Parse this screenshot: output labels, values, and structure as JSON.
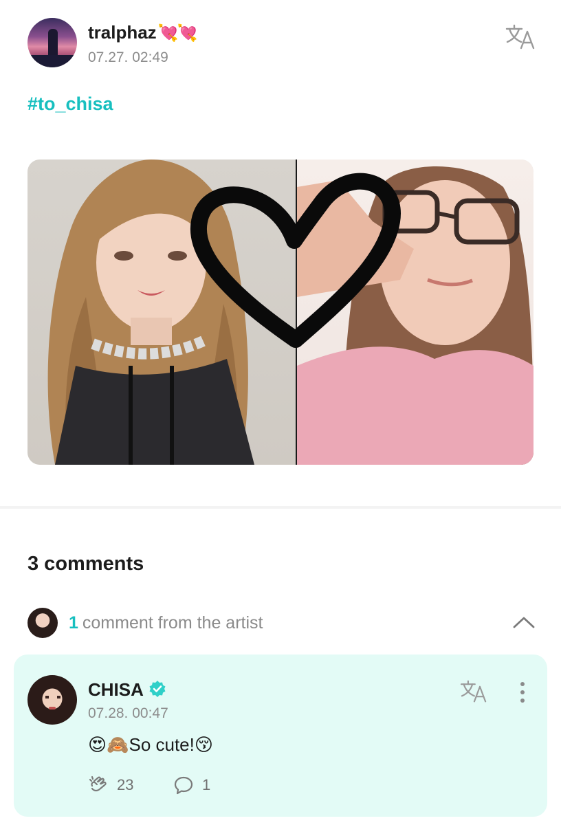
{
  "post": {
    "username": "tralphaz",
    "username_emoji": "💘💘",
    "time": "07.27. 02:49",
    "hashtag": "#to_chisa"
  },
  "comments": {
    "count_label": "3 comments",
    "artist_count": "1",
    "artist_label": "comment from the artist"
  },
  "artist_comment": {
    "name": "CHISA",
    "time": "07.28. 00:47",
    "text": "😍🙈So cute!😚",
    "likes": "23",
    "replies": "1"
  },
  "colors": {
    "accent": "#17bfbf",
    "card_bg": "#e3fbf6",
    "muted": "#8c8c8c"
  },
  "icons": [
    "translate-icon",
    "chevron-up-icon",
    "verified-badge-icon",
    "more-vertical-icon",
    "cheer-hand-icon",
    "reply-bubble-icon"
  ]
}
